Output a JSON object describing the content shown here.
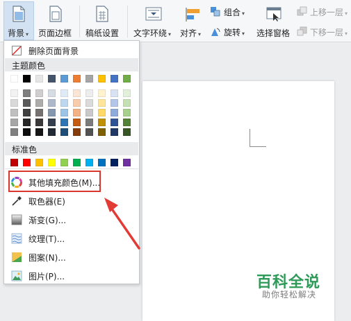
{
  "ribbon": {
    "background": {
      "label": "背景",
      "icon": "page-background-icon"
    },
    "page_border": {
      "label": "页面边框",
      "icon": "page-border-icon"
    },
    "grid_paper": {
      "label": "稿纸设置",
      "icon": "grid-paper-icon"
    },
    "text_wrap": {
      "label": "文字环绕",
      "icon": "text-wrap-icon"
    },
    "align": {
      "label": "对齐",
      "icon": "align-icon"
    },
    "group": {
      "label": "组合",
      "icon": "group-icon"
    },
    "rotate": {
      "label": "旋转",
      "icon": "rotate-icon"
    },
    "selection_pane": {
      "label": "选择窗格",
      "icon": "selection-pane-icon"
    },
    "bring_forward": {
      "label": "上移一层",
      "icon": "bring-forward-icon"
    },
    "send_backward": {
      "label": "下移一层",
      "icon": "send-backward-icon"
    }
  },
  "menu": {
    "delete_background": "删除页面背景",
    "theme_colors_title": "主题颜色",
    "standard_colors_title": "标准色",
    "more_fill_colors": "其他填充颜色(M)...",
    "eyedropper": "取色器(E)",
    "gradient": "渐变(G)...",
    "texture": "纹理(T)...",
    "pattern": "图案(N)...",
    "picture": "图片(P)...",
    "theme_top_row": [
      "#ffffff",
      "#000000",
      "#e7e6e6",
      "#44546a",
      "#5b9bd5",
      "#ed7d31",
      "#a5a5a5",
      "#ffc000",
      "#4472c4",
      "#70ad47"
    ],
    "theme_columns": [
      [
        "#f2f2f2",
        "#d9d9d9",
        "#bfbfbf",
        "#a6a6a6",
        "#808080"
      ],
      [
        "#7f7f7f",
        "#595959",
        "#3f3f3f",
        "#262626",
        "#0d0d0d"
      ],
      [
        "#d0cece",
        "#aeabab",
        "#757171",
        "#3a3838",
        "#171616"
      ],
      [
        "#d6dce4",
        "#adb9ca",
        "#8497b0",
        "#333f4f",
        "#222a35"
      ],
      [
        "#deebf6",
        "#bdd7ee",
        "#9dc3e6",
        "#2e75b6",
        "#1f4e79"
      ],
      [
        "#fbe5d5",
        "#f8cbad",
        "#f4b183",
        "#c55a11",
        "#843c0b"
      ],
      [
        "#ededed",
        "#dbdbdb",
        "#c9c9c9",
        "#7b7b7b",
        "#525252"
      ],
      [
        "#fff2cc",
        "#fee599",
        "#ffd965",
        "#bf9000",
        "#7f6000"
      ],
      [
        "#d9e2f3",
        "#b4c6e7",
        "#8eaadb",
        "#2f5496",
        "#1f3864"
      ],
      [
        "#e2efd9",
        "#c5e0b3",
        "#a8d08d",
        "#538135",
        "#375623"
      ]
    ],
    "standard_colors": [
      "#c00000",
      "#ff0000",
      "#ffc000",
      "#ffff00",
      "#92d050",
      "#00b050",
      "#00b0f0",
      "#0070c0",
      "#002060",
      "#7030a0"
    ],
    "highlight_color": "#d9362d"
  },
  "watermark": {
    "title": "百科全说",
    "subtitle": "助你轻松解决"
  }
}
